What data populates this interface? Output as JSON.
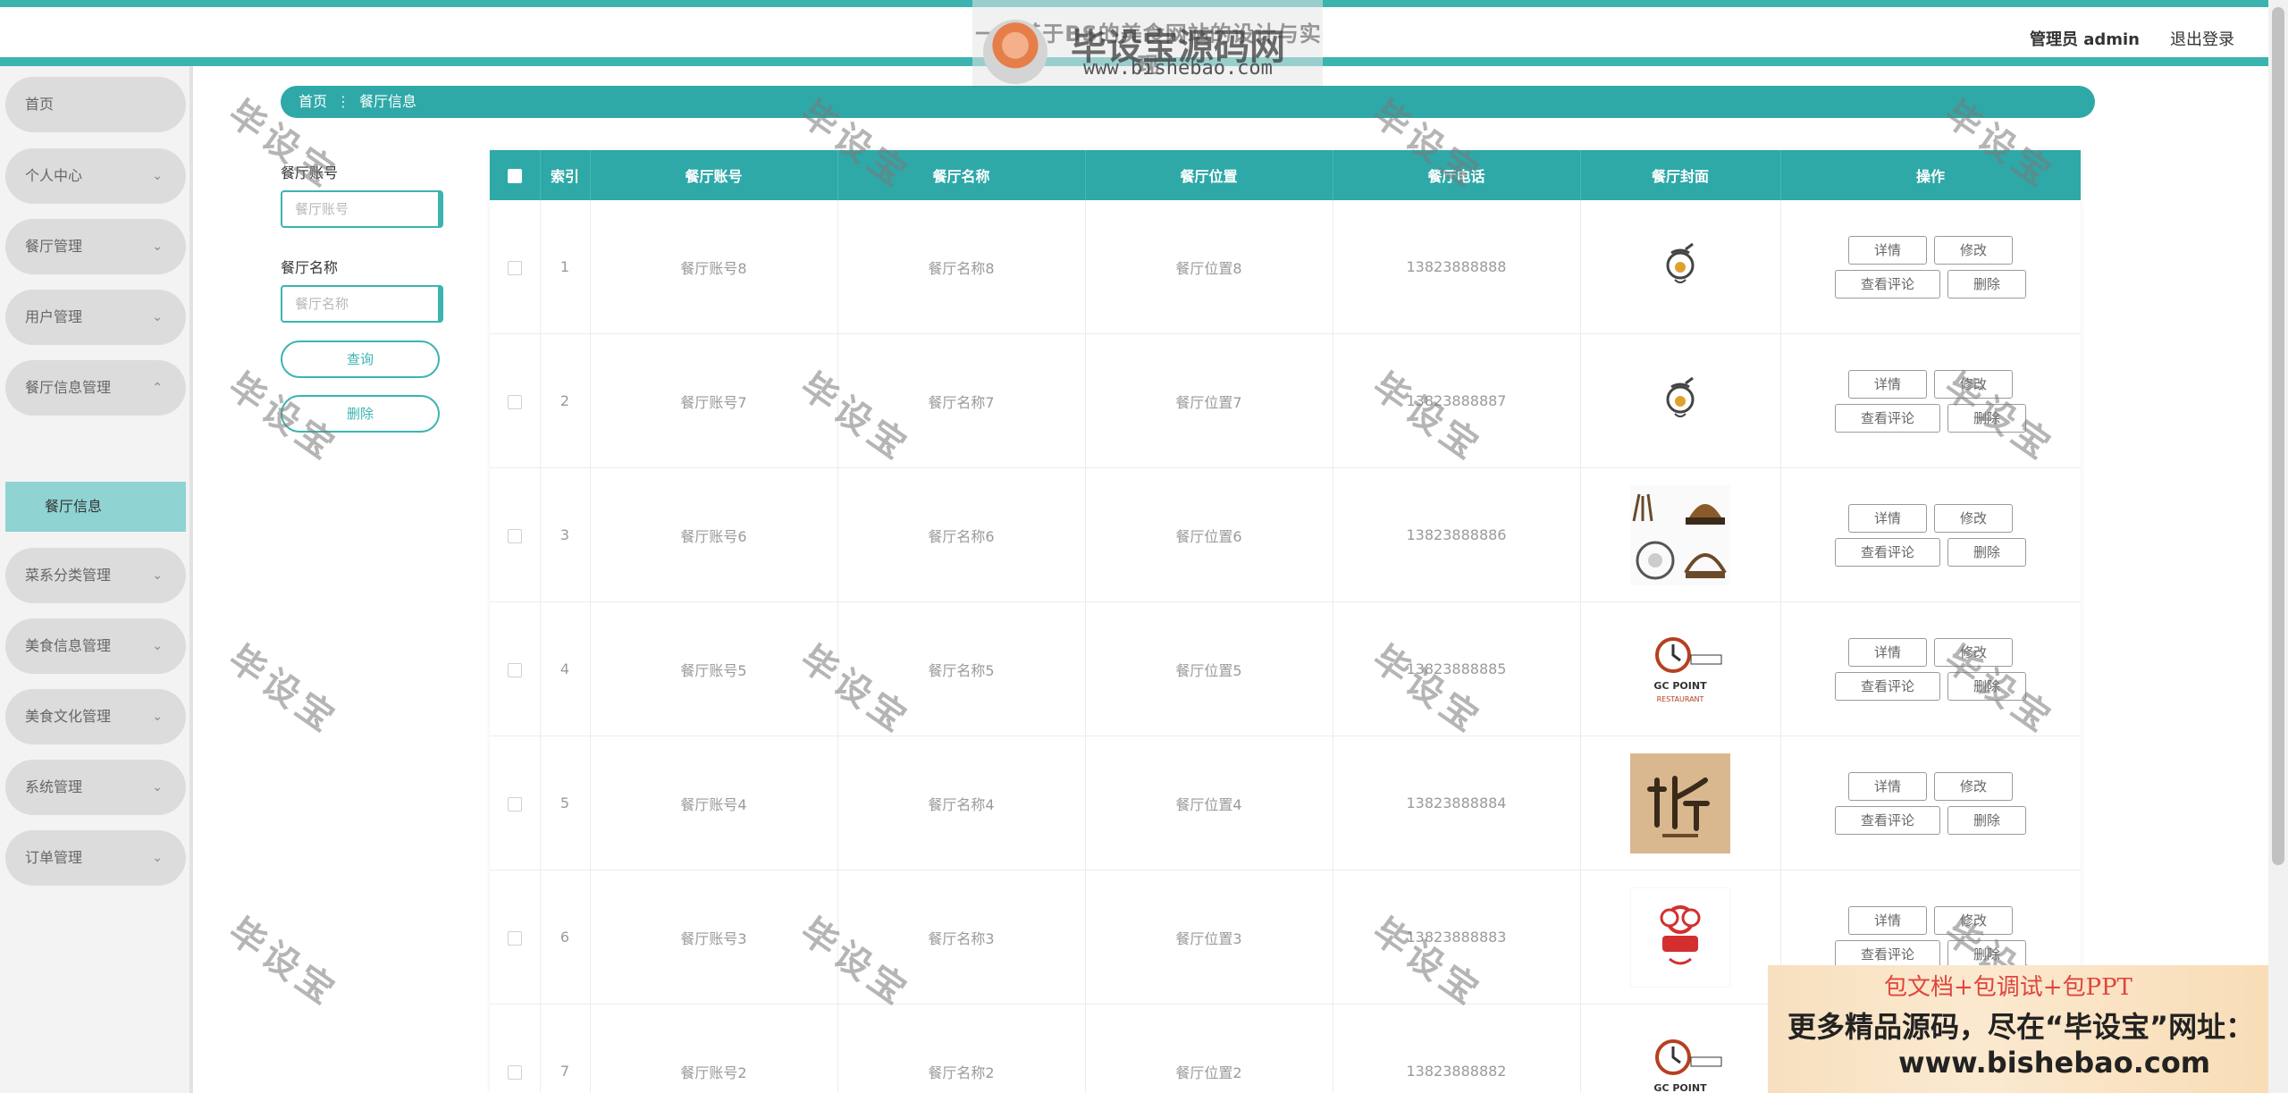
{
  "header": {
    "title": "一款基于BS的美食网站的设计与实现",
    "user": "管理员 admin",
    "logout": "退出登录"
  },
  "watermark_logo": {
    "name": "毕设宝源码网",
    "url": "www.bishebao.com"
  },
  "sidebar": {
    "items": [
      {
        "label": "首页",
        "chevron": false
      },
      {
        "label": "个人中心",
        "chevron": true
      },
      {
        "label": "餐厅管理",
        "chevron": true
      },
      {
        "label": "用户管理",
        "chevron": true
      },
      {
        "label": "餐厅信息管理",
        "chevron": true,
        "expanded": true
      },
      {
        "label": "菜系分类管理",
        "chevron": true
      },
      {
        "label": "美食信息管理",
        "chevron": true
      },
      {
        "label": "美食文化管理",
        "chevron": true
      },
      {
        "label": "系统管理",
        "chevron": true
      },
      {
        "label": "订单管理",
        "chevron": true
      }
    ],
    "active_sub": "餐厅信息"
  },
  "breadcrumb": {
    "home": "首页",
    "sep": "⋮",
    "current": "餐厅信息"
  },
  "search": {
    "account_label": "餐厅账号",
    "account_placeholder": "餐厅账号",
    "name_label": "餐厅名称",
    "name_placeholder": "餐厅名称",
    "query_button": "查询",
    "delete_button": "删除"
  },
  "table": {
    "headers": [
      "索引",
      "餐厅账号",
      "餐厅名称",
      "餐厅位置",
      "餐厅电话",
      "餐厅封面",
      "操作"
    ],
    "rows": [
      {
        "index": "1",
        "account": "餐厅账号8",
        "name": "餐厅名称8",
        "location": "餐厅位置8",
        "phone": "13823888888",
        "cover": "dish-logo"
      },
      {
        "index": "2",
        "account": "餐厅账号7",
        "name": "餐厅名称7",
        "location": "餐厅位置7",
        "phone": "13823888887",
        "cover": "dish-logo"
      },
      {
        "index": "3",
        "account": "餐厅账号6",
        "name": "餐厅名称6",
        "location": "餐厅位置6",
        "phone": "13823888886",
        "cover": "restaurant-badges"
      },
      {
        "index": "4",
        "account": "餐厅账号5",
        "name": "餐厅名称5",
        "location": "餐厅位置5",
        "phone": "13823888885",
        "cover": "gc-point-logo"
      },
      {
        "index": "5",
        "account": "餐厅账号4",
        "name": "餐厅名称4",
        "location": "餐厅位置4",
        "phone": "13823888884",
        "cover": "calligraphy-logo"
      },
      {
        "index": "6",
        "account": "餐厅账号3",
        "name": "餐厅名称3",
        "location": "餐厅位置3",
        "phone": "13823888883",
        "cover": "chef-logo"
      },
      {
        "index": "7",
        "account": "餐厅账号2",
        "name": "餐厅名称2",
        "location": "餐厅位置2",
        "phone": "13823888882",
        "cover": "gc-point-logo"
      }
    ],
    "actions": {
      "detail": "详情",
      "edit": "修改",
      "reviews": "查看评论",
      "delete": "删除"
    }
  },
  "overlay_watermark": "毕设宝",
  "promo": {
    "line1": "包文档+包调试+包PPT",
    "line2": "更多精品源码，尽在“毕设宝”网址：",
    "line3": "www.bishebao.com"
  },
  "colors": {
    "accent": "#2fa8a8",
    "menu_bg": "#dcdcdc",
    "submenu_bg": "#8fd3d3",
    "promo_red": "#e0453c"
  }
}
